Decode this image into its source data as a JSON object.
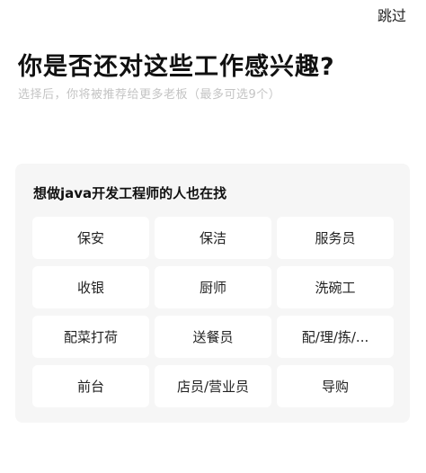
{
  "header": {
    "skip_label": "跳过"
  },
  "page": {
    "title": "你是否还对这些工作感兴趣?",
    "subtitle": "选择后，你将被推荐给更多老板（最多可选9个）"
  },
  "card": {
    "title": "想做java开发工程师的人也在找",
    "tags": [
      "保安",
      "保洁",
      "服务员",
      "收银",
      "厨师",
      "洗碗工",
      "配菜打荷",
      "送餐员",
      "配/理/拣/...",
      "前台",
      "店员/营业员",
      "导购"
    ]
  }
}
